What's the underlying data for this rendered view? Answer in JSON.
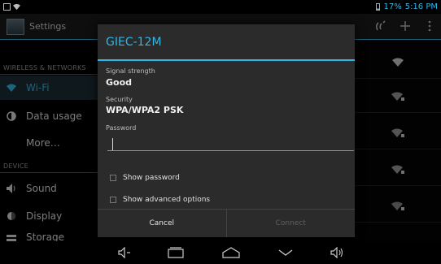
{
  "status_bar": {
    "battery": "17%",
    "time": "5:16 PM"
  },
  "app": {
    "title": "Settings"
  },
  "sidebar": {
    "headers": {
      "wireless": "WIRELESS & NETWORKS",
      "device": "DEVICE"
    },
    "items": [
      {
        "label": "Wi-Fi",
        "icon": "wifi-icon"
      },
      {
        "label": "Data usage",
        "icon": "data-usage-icon"
      },
      {
        "label": "More…",
        "icon": ""
      },
      {
        "label": "Sound",
        "icon": "speaker-icon"
      },
      {
        "label": "Display",
        "icon": "display-icon"
      },
      {
        "label": "Storage",
        "icon": "storage-icon"
      }
    ]
  },
  "dialog": {
    "title": "GIEC-12M",
    "signal_label": "Signal strength",
    "signal_value": "Good",
    "security_label": "Security",
    "security_value": "WPA/WPA2 PSK",
    "password_label": "Password",
    "password_value": "",
    "show_password": "Show password",
    "show_advanced": "Show advanced options",
    "cancel": "Cancel",
    "connect": "Connect"
  },
  "colors": {
    "accent": "#33b5e5",
    "dialog_bg": "#2b2b2b"
  }
}
